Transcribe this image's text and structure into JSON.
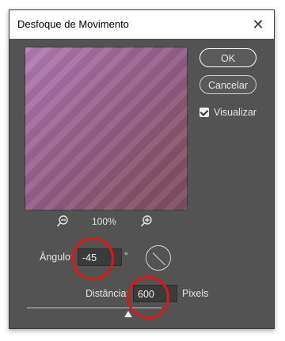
{
  "dialog": {
    "title": "Desfoque de Movimento",
    "close_symbol": "✕"
  },
  "buttons": {
    "ok_label": "OK",
    "cancel_label": "Cancelar"
  },
  "preview": {
    "checkbox_label": "Visualizar",
    "checked": true,
    "zoom_level": "100%"
  },
  "angle": {
    "label": "Ângulo:",
    "value": "-45",
    "unit": "°"
  },
  "distance": {
    "label": "Distância:",
    "value": "600",
    "unit": "Pixels"
  },
  "icons": [
    "zoom-out-icon",
    "zoom-in-icon",
    "checkmark-icon",
    "angle-dial-icon",
    "close-icon"
  ],
  "colors": {
    "dialog_bg": "#535353",
    "annotation_red": "#e01515"
  }
}
